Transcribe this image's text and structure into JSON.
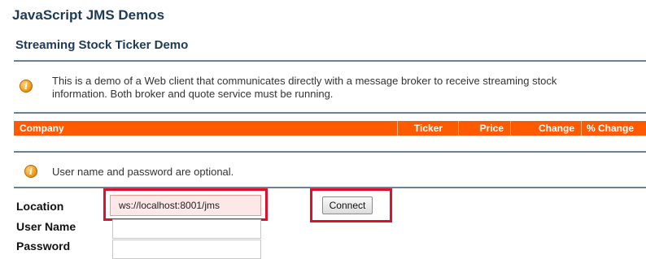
{
  "app_title": "JavaScript JMS Demos",
  "page_title": "Streaming Stock Ticker Demo",
  "intro": {
    "icon": "info-icon",
    "line1": "This is a demo of a Web client that communicates directly with a message broker to receive streaming stock",
    "line2": "information. Both broker and quote service must be running."
  },
  "table": {
    "header_color": "#ff5a00",
    "columns": [
      "Company",
      "Ticker",
      "Price",
      "Change",
      "% Change"
    ]
  },
  "note": {
    "icon": "info-icon",
    "text": "User name and password are optional."
  },
  "form": {
    "location_label": "Location",
    "location_value": "ws://localhost:8001/jms",
    "username_label": "User Name",
    "username_value": "",
    "password_label": "Password",
    "password_value": "",
    "connect_label": "Connect"
  },
  "colors": {
    "title": "#1d3a57",
    "highlight": "#e0102a"
  }
}
